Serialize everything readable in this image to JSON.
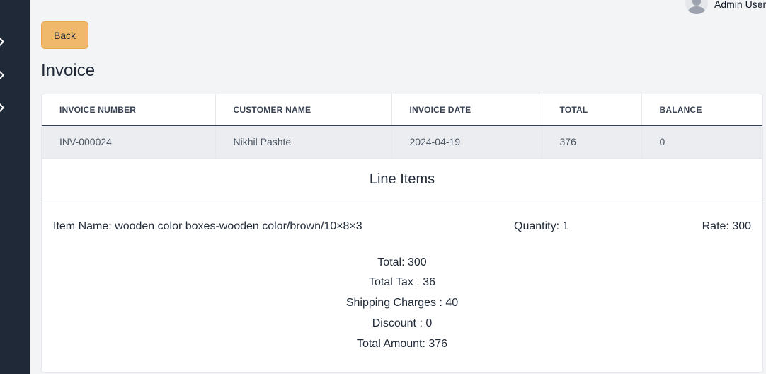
{
  "header": {
    "user_name": "Admin User"
  },
  "actions": {
    "back_label": "Back"
  },
  "page": {
    "title": "Invoice"
  },
  "invoice_table": {
    "columns": [
      "INVOICE NUMBER",
      "CUSTOMER NAME",
      "INVOICE DATE",
      "TOTAL",
      "BALANCE"
    ],
    "row": [
      "INV-000024",
      "Nikhil Pashte",
      "2024-04-19",
      "376",
      "0"
    ]
  },
  "line_items": {
    "title": "Line Items",
    "item": {
      "name": "Item Name: wooden color boxes-wooden color/brown/10×8×3",
      "quantity": "Quantity: 1",
      "rate": "Rate: 300"
    }
  },
  "totals": {
    "total": "Total: 300",
    "total_tax": "Total Tax : 36",
    "shipping": "Shipping Charges : 40",
    "discount": "Discount : 0",
    "total_amount": "Total Amount: 376"
  },
  "colors": {
    "sidebar": "#1f2937",
    "back_button": "#f0b86a",
    "page_background": "#f3f4f6"
  },
  "icons": [
    "chevron-right-icon",
    "chevron-right-icon",
    "chevron-right-icon",
    "user-avatar-icon"
  ]
}
